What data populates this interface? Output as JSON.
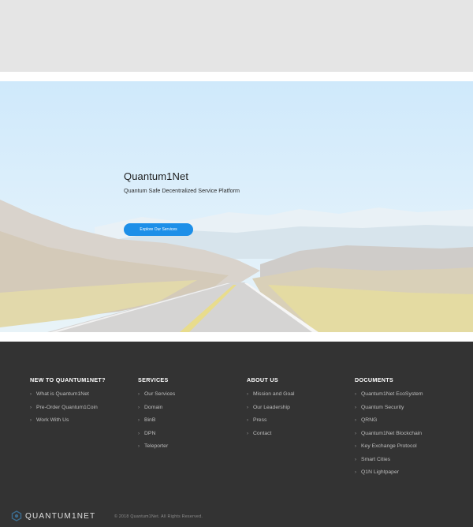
{
  "hero": {
    "title": "Quantum1Net",
    "subtitle": "Quantum Safe Decentralized Service Platform",
    "button_label": "Explore Our Services"
  },
  "footer": {
    "columns": [
      {
        "heading": "NEW TO QUANTUM1NET?",
        "links": [
          "What is Quantum1Net",
          "Pre-Order Quantum1Coin",
          "Work With Us"
        ]
      },
      {
        "heading": "SERVICES",
        "links": [
          "Our Services",
          "Domain",
          "BinB",
          "DPN",
          "Teleporter"
        ]
      },
      {
        "heading": "ABOUT US",
        "links": [
          "Mission and Goal",
          "Our Leadership",
          "Press",
          "Contact"
        ]
      },
      {
        "heading": "DOCUMENTS",
        "links": [
          "Quantum1Net EcoSystem",
          "Quantum Security",
          "QRNG",
          "Quantum1Net Blockchain",
          "Key Exchange Protocol",
          "Smart Cities",
          "Q1N Lightpaper"
        ]
      }
    ],
    "logo_text": "QUANTUM1NET",
    "copyright": "© 2018 Quantum1Net. All Rights Reserved."
  },
  "colors": {
    "accent": "#1d8fe8",
    "footer_bg": "#333333",
    "top_band": "#e5e5e5"
  },
  "icons": {
    "link_bullet": "chevron-right-icon",
    "logo": "quantum-logo-icon"
  }
}
